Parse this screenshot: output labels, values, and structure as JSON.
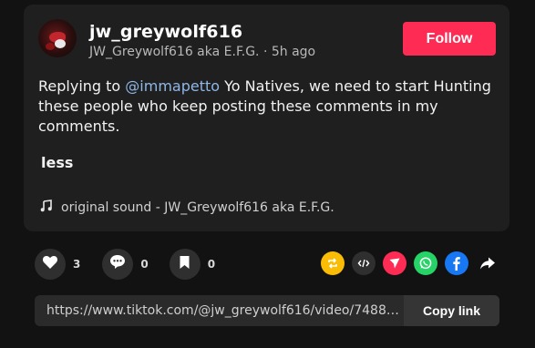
{
  "post": {
    "username": "jw_greywolf616",
    "display_name": "JW_Greywolf616 aka E.F.G.",
    "separator": "·",
    "time_ago": "5h ago",
    "follow_label": "Follow",
    "caption_prefix": "Replying to",
    "mention": "@immapetto",
    "caption_body": "Yo Natives, we need to start Hunting these people who keep posting these comments in my comments.",
    "less_label": "less",
    "sound_label": "original sound - JW_Greywolf616 aka E.F.G."
  },
  "actions": {
    "likes": "3",
    "comments": "0",
    "saves": "0"
  },
  "share_icons": [
    "repost-icon",
    "embed-icon",
    "send-to-friends-icon",
    "whatsapp-icon",
    "facebook-icon",
    "share-arrow-icon"
  ],
  "link": {
    "url": "https://www.tiktok.com/@jw_greywolf616/video/74881...",
    "copy_label": "Copy link"
  },
  "colors": {
    "follow": "#fe2c55",
    "mention": "#8fb7e8",
    "repost": "#fbbc05",
    "send": "#fe2c55",
    "whatsapp": "#25d366",
    "facebook": "#1877f2"
  }
}
